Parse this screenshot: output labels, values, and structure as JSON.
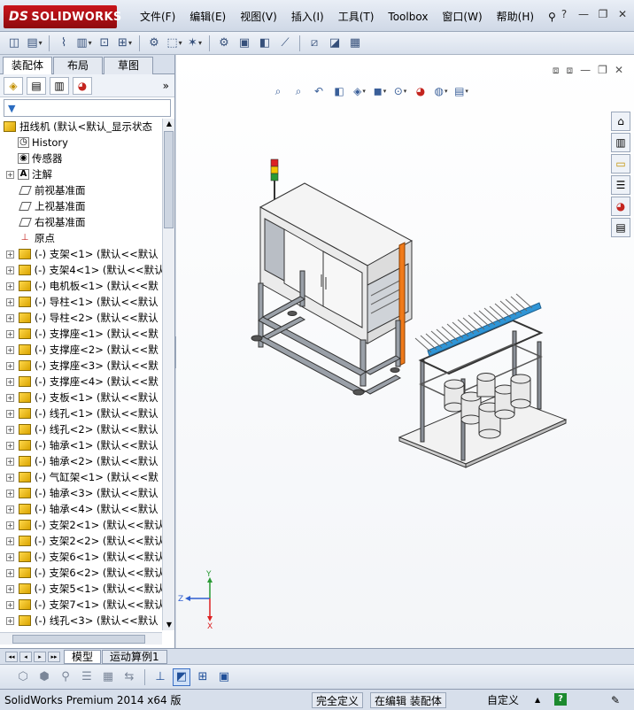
{
  "app": {
    "logo_text": "SOLIDWORKS",
    "logo_prefix": "DS"
  },
  "menu": [
    "文件(F)",
    "编辑(E)",
    "视图(V)",
    "插入(I)",
    "工具(T)",
    "Toolbox",
    "窗口(W)",
    "帮助(H)"
  ],
  "window_controls": {
    "help": "?",
    "minimize": "—",
    "restore": "❐",
    "close": "✕"
  },
  "panel_tabs": [
    "装配体",
    "布局",
    "草图"
  ],
  "manager_more": "»",
  "filter_icon": "▼",
  "tree": {
    "root": "扭线机  (默认<默认_显示状态",
    "fixed": [
      {
        "label": "History",
        "icon": "history-icon",
        "expand": false
      },
      {
        "label": "传感器",
        "icon": "sensor-icon",
        "expand": false
      },
      {
        "label": "注解",
        "icon": "annotation-icon",
        "expand": true
      },
      {
        "label": "前视基准面",
        "icon": "plane-icon",
        "expand": false
      },
      {
        "label": "上视基准面",
        "icon": "plane-icon",
        "expand": false
      },
      {
        "label": "右视基准面",
        "icon": "plane-icon",
        "expand": false
      },
      {
        "label": "原点",
        "icon": "origin-icon",
        "expand": false
      }
    ],
    "components": [
      "(-) 支架<1> (默认<<默认",
      "(-) 支架4<1> (默认<<默认",
      "(-) 电机板<1> (默认<<默",
      "(-) 导柱<1> (默认<<默认",
      "(-) 导柱<2> (默认<<默认",
      "(-) 支撑座<1> (默认<<默",
      "(-) 支撑座<2> (默认<<默",
      "(-) 支撑座<3> (默认<<默",
      "(-) 支撑座<4> (默认<<默",
      "(-) 支板<1> (默认<<默认",
      "(-) 线孔<1> (默认<<默认",
      "(-) 线孔<2> (默认<<默认",
      "(-) 轴承<1> (默认<<默认",
      "(-) 轴承<2> (默认<<默认",
      "(-) 气缸架<1> (默认<<默",
      "(-) 轴承<3> (默认<<默认",
      "(-) 轴承<4> (默认<<默认",
      "(-) 支架2<1> (默认<<默认",
      "(-) 支架2<2> (默认<<默认",
      "(-) 支架6<1> (默认<<默认",
      "(-) 支架6<2> (默认<<默认",
      "(-) 支架5<1> (默认<<默认",
      "(-) 支架7<1> (默认<<默认",
      "(-) 线孔<3> (默认<<默认"
    ]
  },
  "triad": {
    "y": "Y",
    "x": "X",
    "z": "Z"
  },
  "bottom_tabs": [
    "模型",
    "运动算例1"
  ],
  "status": {
    "version": "SolidWorks Premium 2014 x64 版",
    "definition": "完全定义",
    "editing": "在编辑 装配体",
    "units": "自定义",
    "units_arrow": "▲",
    "help": "?"
  },
  "colors": {
    "logo_red": "#c9151b",
    "frame_aluminum": "#9aa0a8",
    "panel": "#f2f2f2",
    "accent_orange": "#f07a1a",
    "guide_blue": "#2f95d6"
  }
}
